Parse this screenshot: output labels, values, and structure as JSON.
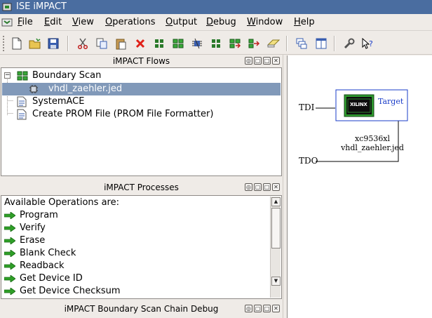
{
  "window": {
    "title": "ISE iMPACT"
  },
  "menu": [
    {
      "key": "F",
      "rest": "ile"
    },
    {
      "key": "E",
      "rest": "dit"
    },
    {
      "key": "V",
      "rest": "iew"
    },
    {
      "key": "O",
      "rest": "perations"
    },
    {
      "key": "O",
      "rest": "utput"
    },
    {
      "key": "D",
      "rest": "ebug"
    },
    {
      "key": "W",
      "rest": "indow"
    },
    {
      "key": "H",
      "rest": "elp"
    }
  ],
  "flows": {
    "header": "iMPACT Flows",
    "items": [
      "Boundary Scan",
      "vhdl_zaehler.jed",
      "SystemACE",
      "Create PROM File (PROM File Formatter)"
    ]
  },
  "processes": {
    "header": "iMPACT Processes",
    "intro": "Available Operations are:",
    "ops": [
      "Program",
      "Verify",
      "Erase",
      "Blank Check",
      "Readback",
      "Get Device ID",
      "Get Device Checksum"
    ]
  },
  "chain_debug": {
    "header": "iMPACT Boundary Scan Chain Debug"
  },
  "canvas": {
    "tdi": "TDI",
    "tdo": "TDO",
    "target": "Target",
    "chip_logo": "XILINX",
    "device": "xc9536xl",
    "file": "vhdl_zaehler.jed"
  },
  "colors": {
    "titlebar": "#4a6da0",
    "selection": "#8199b9",
    "target_text": "#1a3cc8",
    "arrow_green": "#2fa028"
  }
}
